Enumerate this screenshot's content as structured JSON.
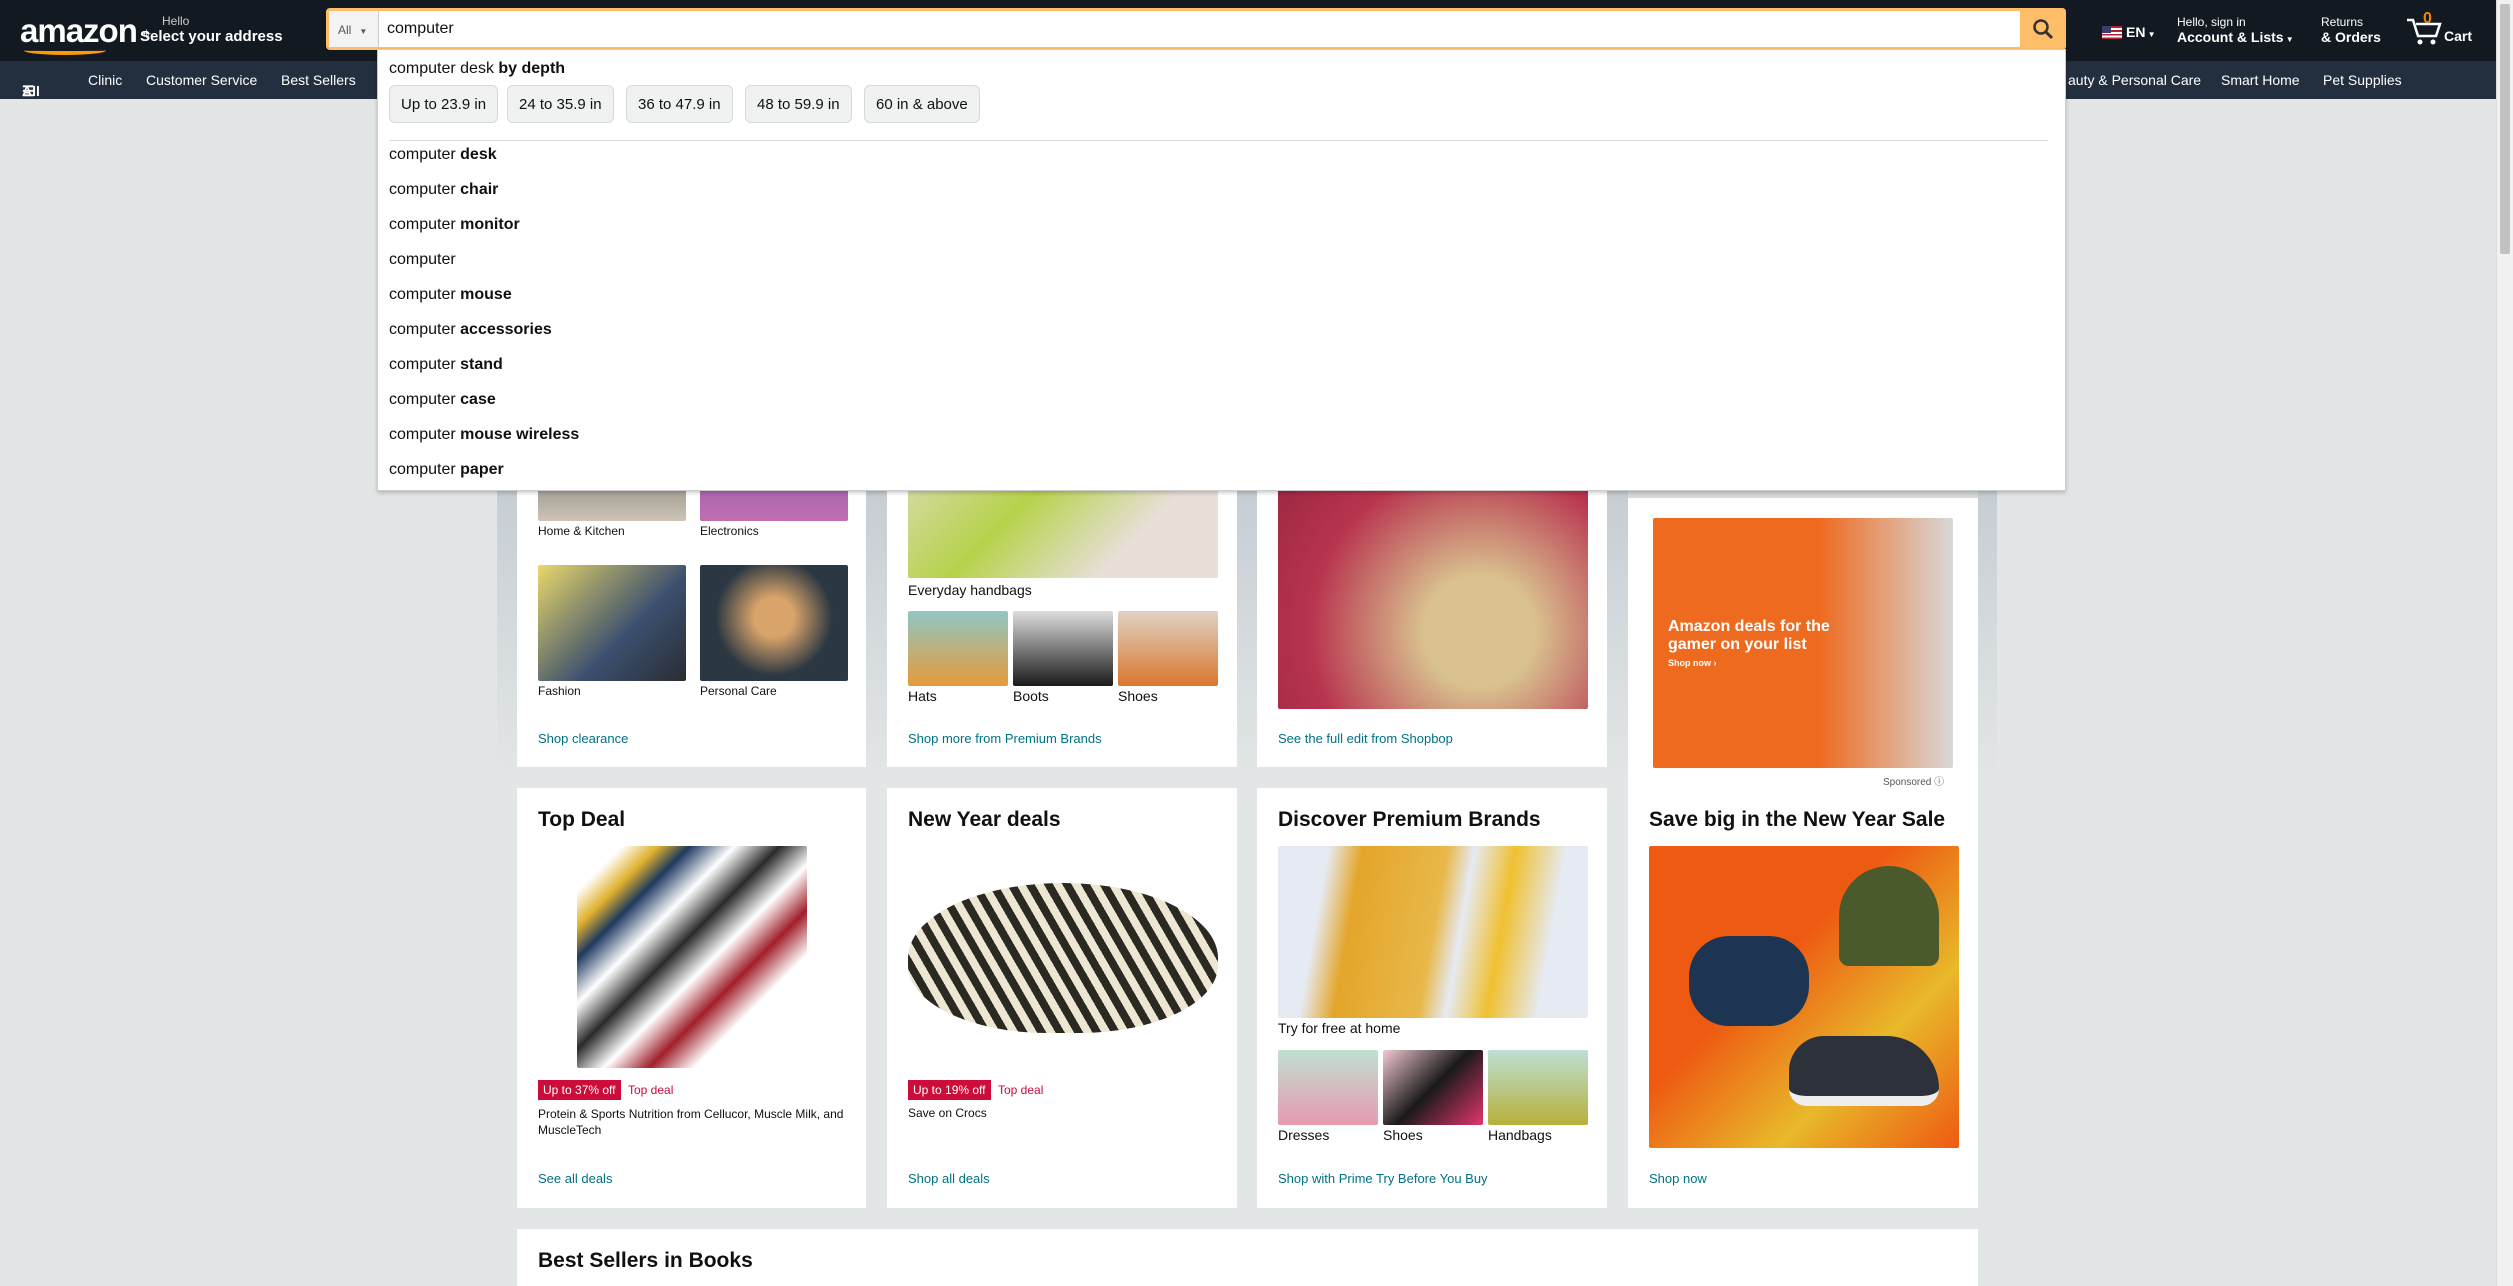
{
  "header": {
    "logo": "amazon",
    "address_line1": "Hello",
    "address_line2": "Select your address",
    "search_category": "All",
    "search_value": "computer",
    "lang": "EN",
    "account_line1": "Hello, sign in",
    "account_line2": "Account & Lists",
    "returns_line1": "Returns",
    "returns_line2": "& Orders",
    "cart_count": "0",
    "cart_label": "Cart"
  },
  "subnav": {
    "all": "All",
    "items": [
      "Clinic",
      "Customer Service",
      "Best Sellers"
    ],
    "right_items": [
      "auty & Personal Care",
      "Smart Home",
      "Pet Supplies"
    ]
  },
  "dropdown": {
    "header_prefix": "computer desk ",
    "header_bold": "by depth",
    "chips": [
      "Up to 23.9 in",
      "24 to 35.9 in",
      "36 to 47.9 in",
      "48 to 59.9 in",
      "60 in & above"
    ],
    "suggestions": [
      {
        "prefix": "computer ",
        "bold": "desk"
      },
      {
        "prefix": "computer ",
        "bold": "chair"
      },
      {
        "prefix": "computer ",
        "bold": "monitor"
      },
      {
        "prefix": "computer",
        "bold": ""
      },
      {
        "prefix": "computer ",
        "bold": "mouse"
      },
      {
        "prefix": "computer ",
        "bold": "accessories"
      },
      {
        "prefix": "computer ",
        "bold": "stand"
      },
      {
        "prefix": "computer ",
        "bold": "case"
      },
      {
        "prefix": "computer ",
        "bold": "mouse wireless"
      },
      {
        "prefix": "computer ",
        "bold": "paper"
      }
    ]
  },
  "row1": {
    "card1": {
      "labels": [
        "Home & Kitchen",
        "Electronics",
        "Fashion",
        "Personal Care"
      ],
      "link": "Shop clearance"
    },
    "card2": {
      "main": "Everyday handbags",
      "labels": [
        "Hats",
        "Boots",
        "Shoes"
      ],
      "link": "Shop more from Premium Brands"
    },
    "card3": {
      "link": "See the full edit from Shopbop"
    },
    "ad": {
      "text": "Amazon deals for the gamer on your list",
      "cta": "Shop now ›",
      "sponsored": "Sponsored"
    }
  },
  "row2": {
    "card1": {
      "title": "Top Deal",
      "badge": "Up to 37% off",
      "deal": "Top deal",
      "desc": "Protein & Sports Nutrition from Cellucor, Muscle Milk, and MuscleTech",
      "link": "See all deals"
    },
    "card2": {
      "title": "New Year deals",
      "badge": "Up to 19% off",
      "deal": "Top deal",
      "desc": "Save on Crocs",
      "link": "Shop all deals"
    },
    "card3": {
      "title": "Discover Premium Brands",
      "main": "Try for free at home",
      "labels": [
        "Dresses",
        "Shoes",
        "Handbags"
      ],
      "link": "Shop with Prime Try Before You Buy"
    },
    "card4": {
      "title": "Save big in the New Year Sale",
      "link": "Shop now"
    }
  },
  "row3": {
    "title": "Best Sellers in Books"
  },
  "colors": {
    "header": "#131921",
    "subnav": "#232f3e",
    "accent": "#febd69",
    "link": "#007185",
    "deal": "#cc0c39"
  }
}
